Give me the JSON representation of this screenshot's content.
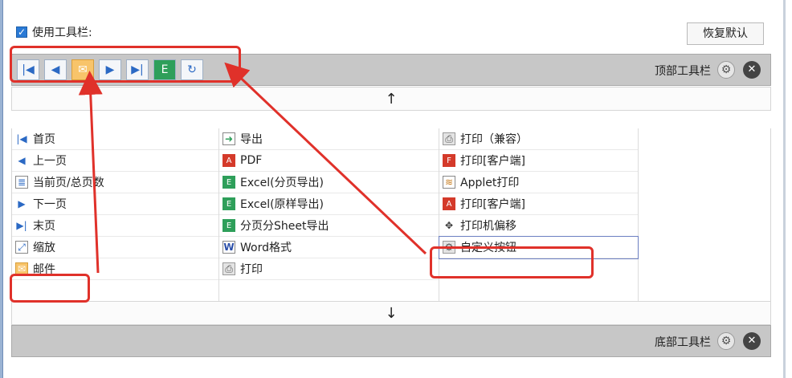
{
  "header": {
    "use_toolbar_label": "使用工具栏:",
    "restore_button_label": "恢复默认"
  },
  "top_toolbar": {
    "label": "顶部工具栏",
    "icons": [
      "first-page-icon",
      "prev-page-icon",
      "mail-icon",
      "next-page-icon",
      "last-page-icon",
      "excel-icon",
      "refresh-icon"
    ]
  },
  "bottom_toolbar": {
    "label": "底部工具栏"
  },
  "arrows": {
    "up": "↑",
    "down": "↓"
  },
  "columns": {
    "col1": [
      {
        "label": "首页",
        "icon": "first-page-icon"
      },
      {
        "label": "上一页",
        "icon": "prev-page-icon"
      },
      {
        "label": "当前页/总页数",
        "icon": "page-count-icon"
      },
      {
        "label": "下一页",
        "icon": "next-page-icon"
      },
      {
        "label": "末页",
        "icon": "last-page-icon"
      },
      {
        "label": "缩放",
        "icon": "zoom-icon"
      },
      {
        "label": "邮件",
        "icon": "mail-icon"
      }
    ],
    "col2": [
      {
        "label": "导出",
        "icon": "export-icon"
      },
      {
        "label": "PDF",
        "icon": "pdf-icon"
      },
      {
        "label": "Excel(分页导出)",
        "icon": "excel-icon"
      },
      {
        "label": "Excel(原样导出)",
        "icon": "excel-icon"
      },
      {
        "label": "分页分Sheet导出",
        "icon": "excel-icon"
      },
      {
        "label": "Word格式",
        "icon": "word-icon"
      },
      {
        "label": "打印",
        "icon": "print-icon"
      }
    ],
    "col3": [
      {
        "label": "打印（兼容）",
        "icon": "print-icon"
      },
      {
        "label": "打印[客户端]",
        "icon": "flash-print-icon"
      },
      {
        "label": "Applet打印",
        "icon": "applet-print-icon"
      },
      {
        "label": "打印[客户端]",
        "icon": "pdf-print-icon"
      },
      {
        "label": "打印机偏移",
        "icon": "move-icon"
      },
      {
        "label": "自定义按钮",
        "icon": "gear-icon"
      }
    ]
  },
  "colors": {
    "toolbar_bg": "#c7c7c7",
    "highlight_red": "#e0312a",
    "checkbox_blue": "#2a7ad6"
  }
}
